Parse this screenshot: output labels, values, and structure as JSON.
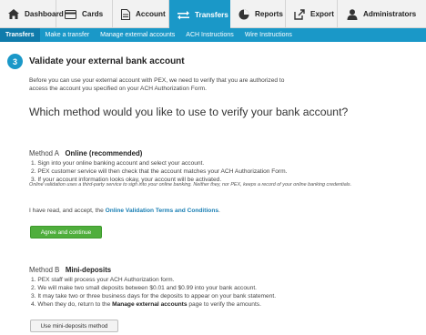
{
  "top_nav": [
    {
      "label": "Dashboard",
      "icon": "home-icon"
    },
    {
      "label": "Cards",
      "icon": "card-icon"
    },
    {
      "label": "Account",
      "icon": "document-icon"
    },
    {
      "label": "Transfers",
      "icon": "transfer-arrows-icon",
      "active": true
    },
    {
      "label": "Reports",
      "icon": "pie-chart-icon"
    },
    {
      "label": "Export",
      "icon": "export-icon"
    },
    {
      "label": "Administrators",
      "icon": "person-icon"
    }
  ],
  "sub_nav": [
    {
      "label": "Transfers",
      "active": true
    },
    {
      "label": "Make a transfer"
    },
    {
      "label": "Manage external accounts"
    },
    {
      "label": "ACH Instructions"
    },
    {
      "label": "Wire Instructions"
    }
  ],
  "step": {
    "number": "3",
    "title": "Validate your external bank account"
  },
  "intro": "Before you can use your external account with PEX, we need to verify that you are authorized to access the account you specified on your ACH Authorization Form.",
  "question": "Which method would you like to use to verify your bank account?",
  "method_a": {
    "prefix": "Method A",
    "name": "Online (recommended)",
    "items": [
      "1. Sign into your online banking account and select your account.",
      "2. PEX customer service will then check that the account matches your ACH Authorization Form.",
      "3. If your account information looks okay, your account will be activated."
    ],
    "note": "Online validation uses a third-party service to sign into your online banking. Neither they, nor PEX, keeps a record of your online banking credentials.",
    "accept_text": "I have read, and accept, the ",
    "accept_link": "Online Validation Terms and Conditions",
    "accept_end": ".",
    "button": "Agree and continue"
  },
  "method_b": {
    "prefix": "Method B",
    "name": "Mini-deposits",
    "items": [
      "1. PEX staff will process your ACH Authorization form.",
      "2. We will make two small deposits between $0.01 and $0.99 into your bank account.",
      "3. It may take two or three business days for the deposits to appear on your bank statement."
    ],
    "item4_pre": "4. When they do, return to the ",
    "item4_bold": "Manage external accounts",
    "item4_post": " page to verify the amounts.",
    "button": "Use mini-deposits method"
  },
  "colors": {
    "accent": "#1a98c8",
    "accent_dark": "#0f7bab",
    "button_green": "#4fae3c",
    "link": "#1a7fb4"
  }
}
